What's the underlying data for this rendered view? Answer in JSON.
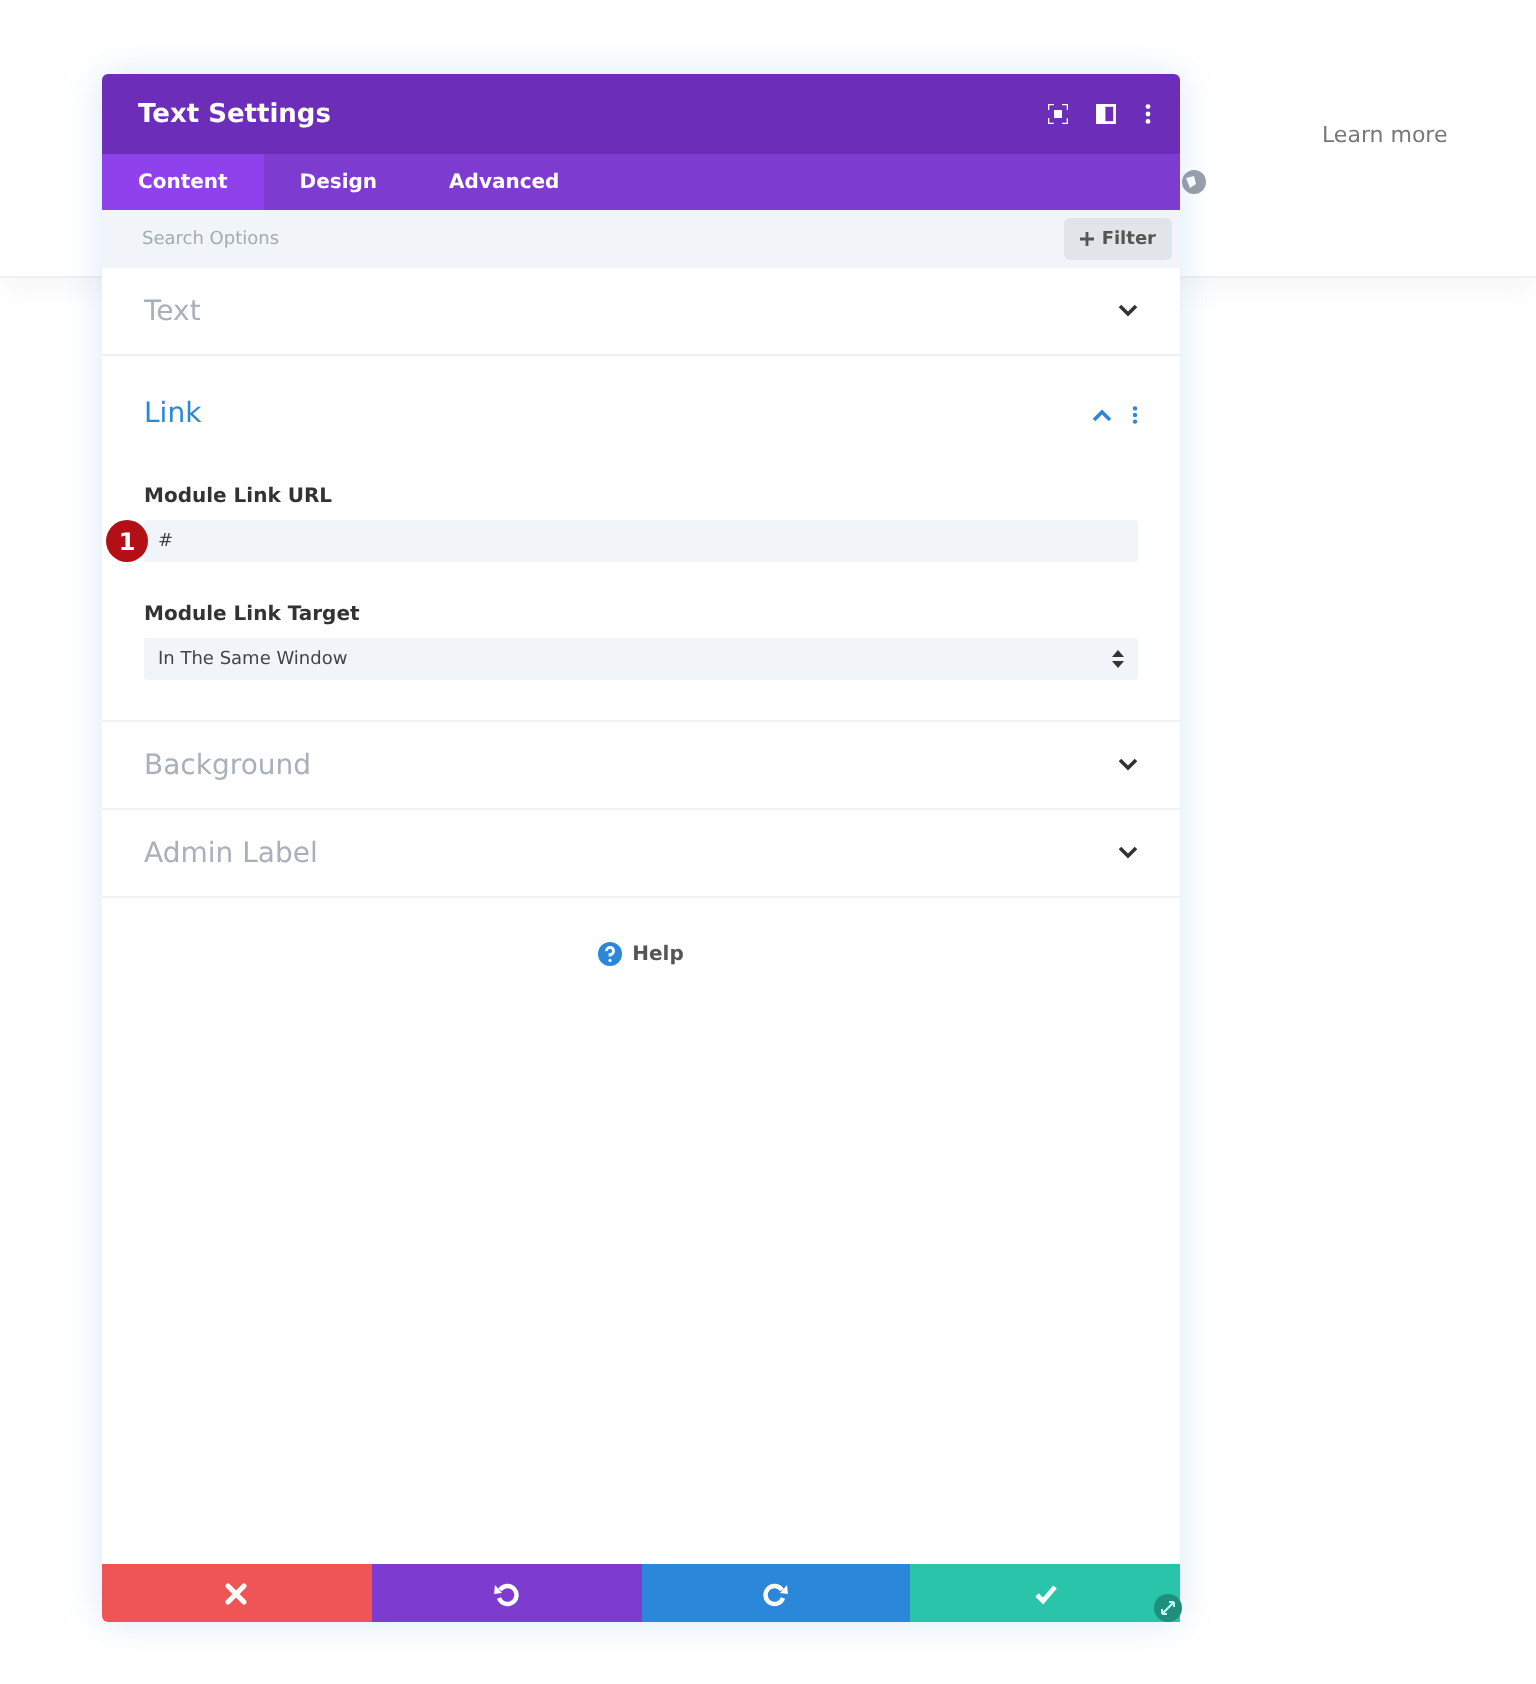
{
  "page": {
    "link": "Learn more"
  },
  "modal": {
    "title": "Text Settings",
    "tabs": [
      {
        "label": "Content",
        "selected": true
      },
      {
        "label": "Design",
        "selected": false
      },
      {
        "label": "Advanced",
        "selected": false
      }
    ],
    "search": {
      "placeholder": "Search Options"
    },
    "filter": "Filter",
    "sections": [
      {
        "title": "Text",
        "expanded": false
      },
      {
        "title": "Link",
        "expanded": true,
        "fields": [
          {
            "kind": "text",
            "label": "Module Link URL",
            "value": "#",
            "marker": "1"
          },
          {
            "kind": "select",
            "label": "Module Link Target",
            "value": "In The Same Window"
          }
        ]
      },
      {
        "title": "Background",
        "expanded": false
      },
      {
        "title": "Admin Label",
        "expanded": false
      }
    ],
    "help": "Help",
    "footer": [
      {
        "kind": "cancel"
      },
      {
        "kind": "undo"
      },
      {
        "kind": "redo"
      },
      {
        "kind": "save"
      }
    ]
  }
}
